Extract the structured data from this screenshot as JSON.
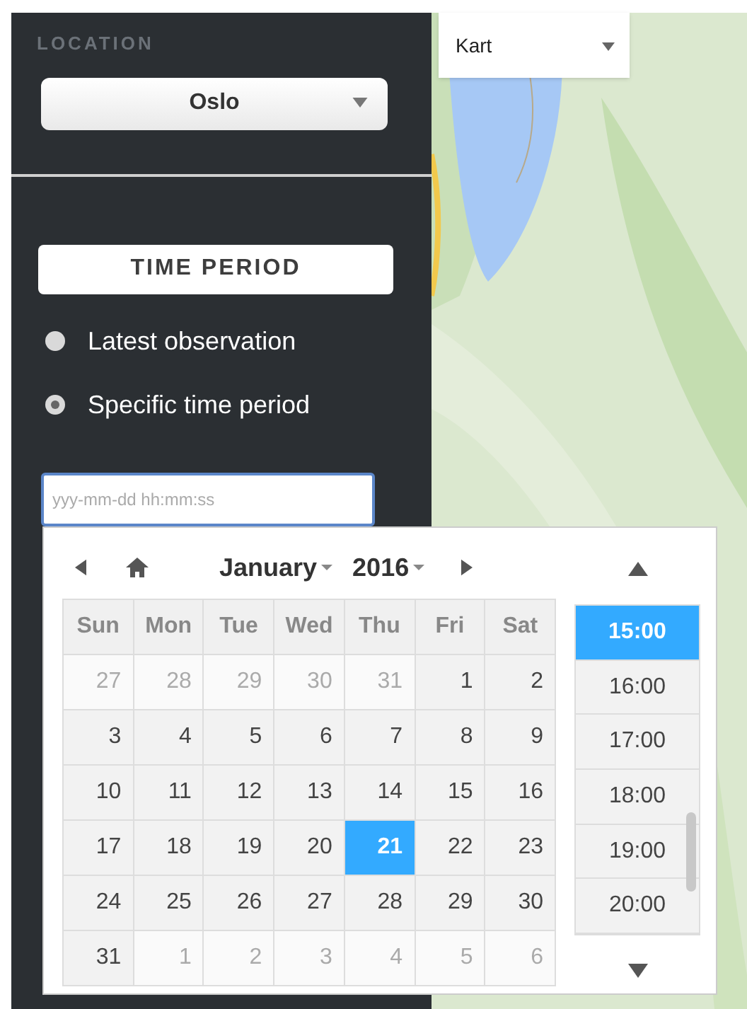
{
  "location": {
    "label": "LOCATION",
    "select": "Oslo"
  },
  "map_type": {
    "select": "Kart"
  },
  "time_period": {
    "title": "TIME PERIOD",
    "options": [
      {
        "label": "Latest observation",
        "selected": false
      },
      {
        "label": "Specific time period",
        "selected": true
      }
    ],
    "input": {
      "placeholder": "yyy-mm-dd hh:mm:ss"
    }
  },
  "datepicker": {
    "month": "January",
    "year": "2016",
    "weekdays": [
      "Sun",
      "Mon",
      "Tue",
      "Wed",
      "Thu",
      "Fri",
      "Sat"
    ],
    "days": [
      {
        "day": "27",
        "muted": true,
        "selected": false
      },
      {
        "day": "28",
        "muted": true,
        "selected": false
      },
      {
        "day": "29",
        "muted": true,
        "selected": false
      },
      {
        "day": "30",
        "muted": true,
        "selected": false
      },
      {
        "day": "31",
        "muted": true,
        "selected": false
      },
      {
        "day": "1",
        "muted": false,
        "selected": false
      },
      {
        "day": "2",
        "muted": false,
        "selected": false
      },
      {
        "day": "3",
        "muted": false,
        "selected": false
      },
      {
        "day": "4",
        "muted": false,
        "selected": false
      },
      {
        "day": "5",
        "muted": false,
        "selected": false
      },
      {
        "day": "6",
        "muted": false,
        "selected": false
      },
      {
        "day": "7",
        "muted": false,
        "selected": false
      },
      {
        "day": "8",
        "muted": false,
        "selected": false
      },
      {
        "day": "9",
        "muted": false,
        "selected": false
      },
      {
        "day": "10",
        "muted": false,
        "selected": false
      },
      {
        "day": "11",
        "muted": false,
        "selected": false
      },
      {
        "day": "12",
        "muted": false,
        "selected": false
      },
      {
        "day": "13",
        "muted": false,
        "selected": false
      },
      {
        "day": "14",
        "muted": false,
        "selected": false
      },
      {
        "day": "15",
        "muted": false,
        "selected": false
      },
      {
        "day": "16",
        "muted": false,
        "selected": false
      },
      {
        "day": "17",
        "muted": false,
        "selected": false
      },
      {
        "day": "18",
        "muted": false,
        "selected": false
      },
      {
        "day": "19",
        "muted": false,
        "selected": false
      },
      {
        "day": "20",
        "muted": false,
        "selected": false
      },
      {
        "day": "21",
        "muted": false,
        "selected": true
      },
      {
        "day": "22",
        "muted": false,
        "selected": false
      },
      {
        "day": "23",
        "muted": false,
        "selected": false
      },
      {
        "day": "24",
        "muted": false,
        "selected": false
      },
      {
        "day": "25",
        "muted": false,
        "selected": false
      },
      {
        "day": "26",
        "muted": false,
        "selected": false
      },
      {
        "day": "27",
        "muted": false,
        "selected": false
      },
      {
        "day": "28",
        "muted": false,
        "selected": false
      },
      {
        "day": "29",
        "muted": false,
        "selected": false
      },
      {
        "day": "30",
        "muted": false,
        "selected": false
      },
      {
        "day": "31",
        "muted": false,
        "selected": false
      },
      {
        "day": "1",
        "muted": true,
        "selected": false
      },
      {
        "day": "2",
        "muted": true,
        "selected": false
      },
      {
        "day": "3",
        "muted": true,
        "selected": false
      },
      {
        "day": "4",
        "muted": true,
        "selected": false
      },
      {
        "day": "5",
        "muted": true,
        "selected": false
      },
      {
        "day": "6",
        "muted": true,
        "selected": false
      }
    ],
    "times": [
      {
        "label": "15:00",
        "selected": true
      },
      {
        "label": "16:00",
        "selected": false
      },
      {
        "label": "17:00",
        "selected": false
      },
      {
        "label": "18:00",
        "selected": false
      },
      {
        "label": "19:00",
        "selected": false
      },
      {
        "label": "20:00",
        "selected": false
      }
    ]
  }
}
